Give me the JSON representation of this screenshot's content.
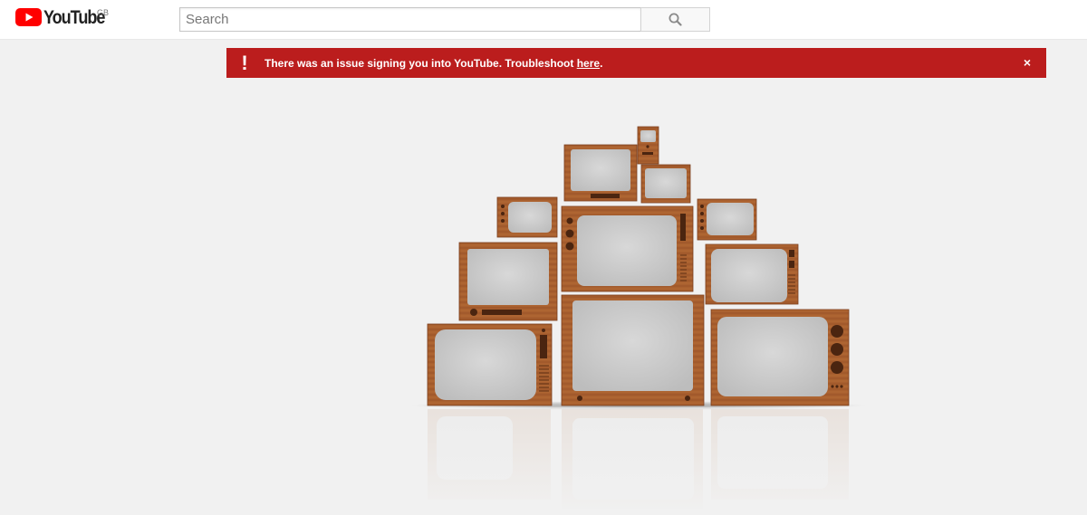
{
  "header": {
    "logo_text": "YouTube",
    "country_code": "GB",
    "logo_icon": "youtube-play-icon",
    "search": {
      "placeholder": "Search",
      "value": "",
      "button_icon": "search-icon"
    }
  },
  "alert": {
    "icon": "exclamation-icon",
    "icon_glyph": "!",
    "message": "There was an issue signing you into YouTube. Troubleshoot ",
    "link_text": "here",
    "message_end": ".",
    "close_glyph": "×",
    "background_color": "#bb1d1d"
  },
  "illustration": {
    "name": "vintage-tv-pile-illustration"
  },
  "colors": {
    "brand_red": "#ff0000",
    "wood": "#a85a2c",
    "screen": "#cfcfcf",
    "page_background": "#f1f1f1"
  }
}
